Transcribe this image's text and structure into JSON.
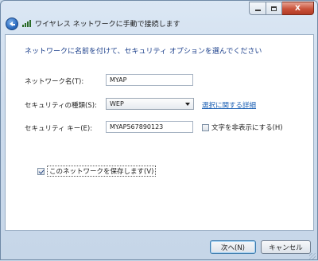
{
  "window": {
    "title": "ワイヤレス ネットワークに手動で接続します",
    "controls": {
      "minimize": "",
      "maximize": "",
      "close": "X"
    }
  },
  "form": {
    "heading": "ネットワークに名前を付けて、セキュリティ オプションを選んでください",
    "network_name_label": "ネットワーク名(T):",
    "network_name_value": "MYAP",
    "security_type_label": "セキュリティの種類(S):",
    "security_type_value": "WEP",
    "security_help_link": "選択に関する詳細",
    "security_key_label": "セキュリティ キー(E):",
    "security_key_value": "MYAP567890123",
    "hide_chars_label": "文字を非表示にする(H)",
    "hide_chars_checked": false,
    "save_network_label": "このネットワークを保存します(V)",
    "save_network_checked": true
  },
  "footer": {
    "next_label": "次へ(N)",
    "cancel_label": "キャンセル"
  }
}
